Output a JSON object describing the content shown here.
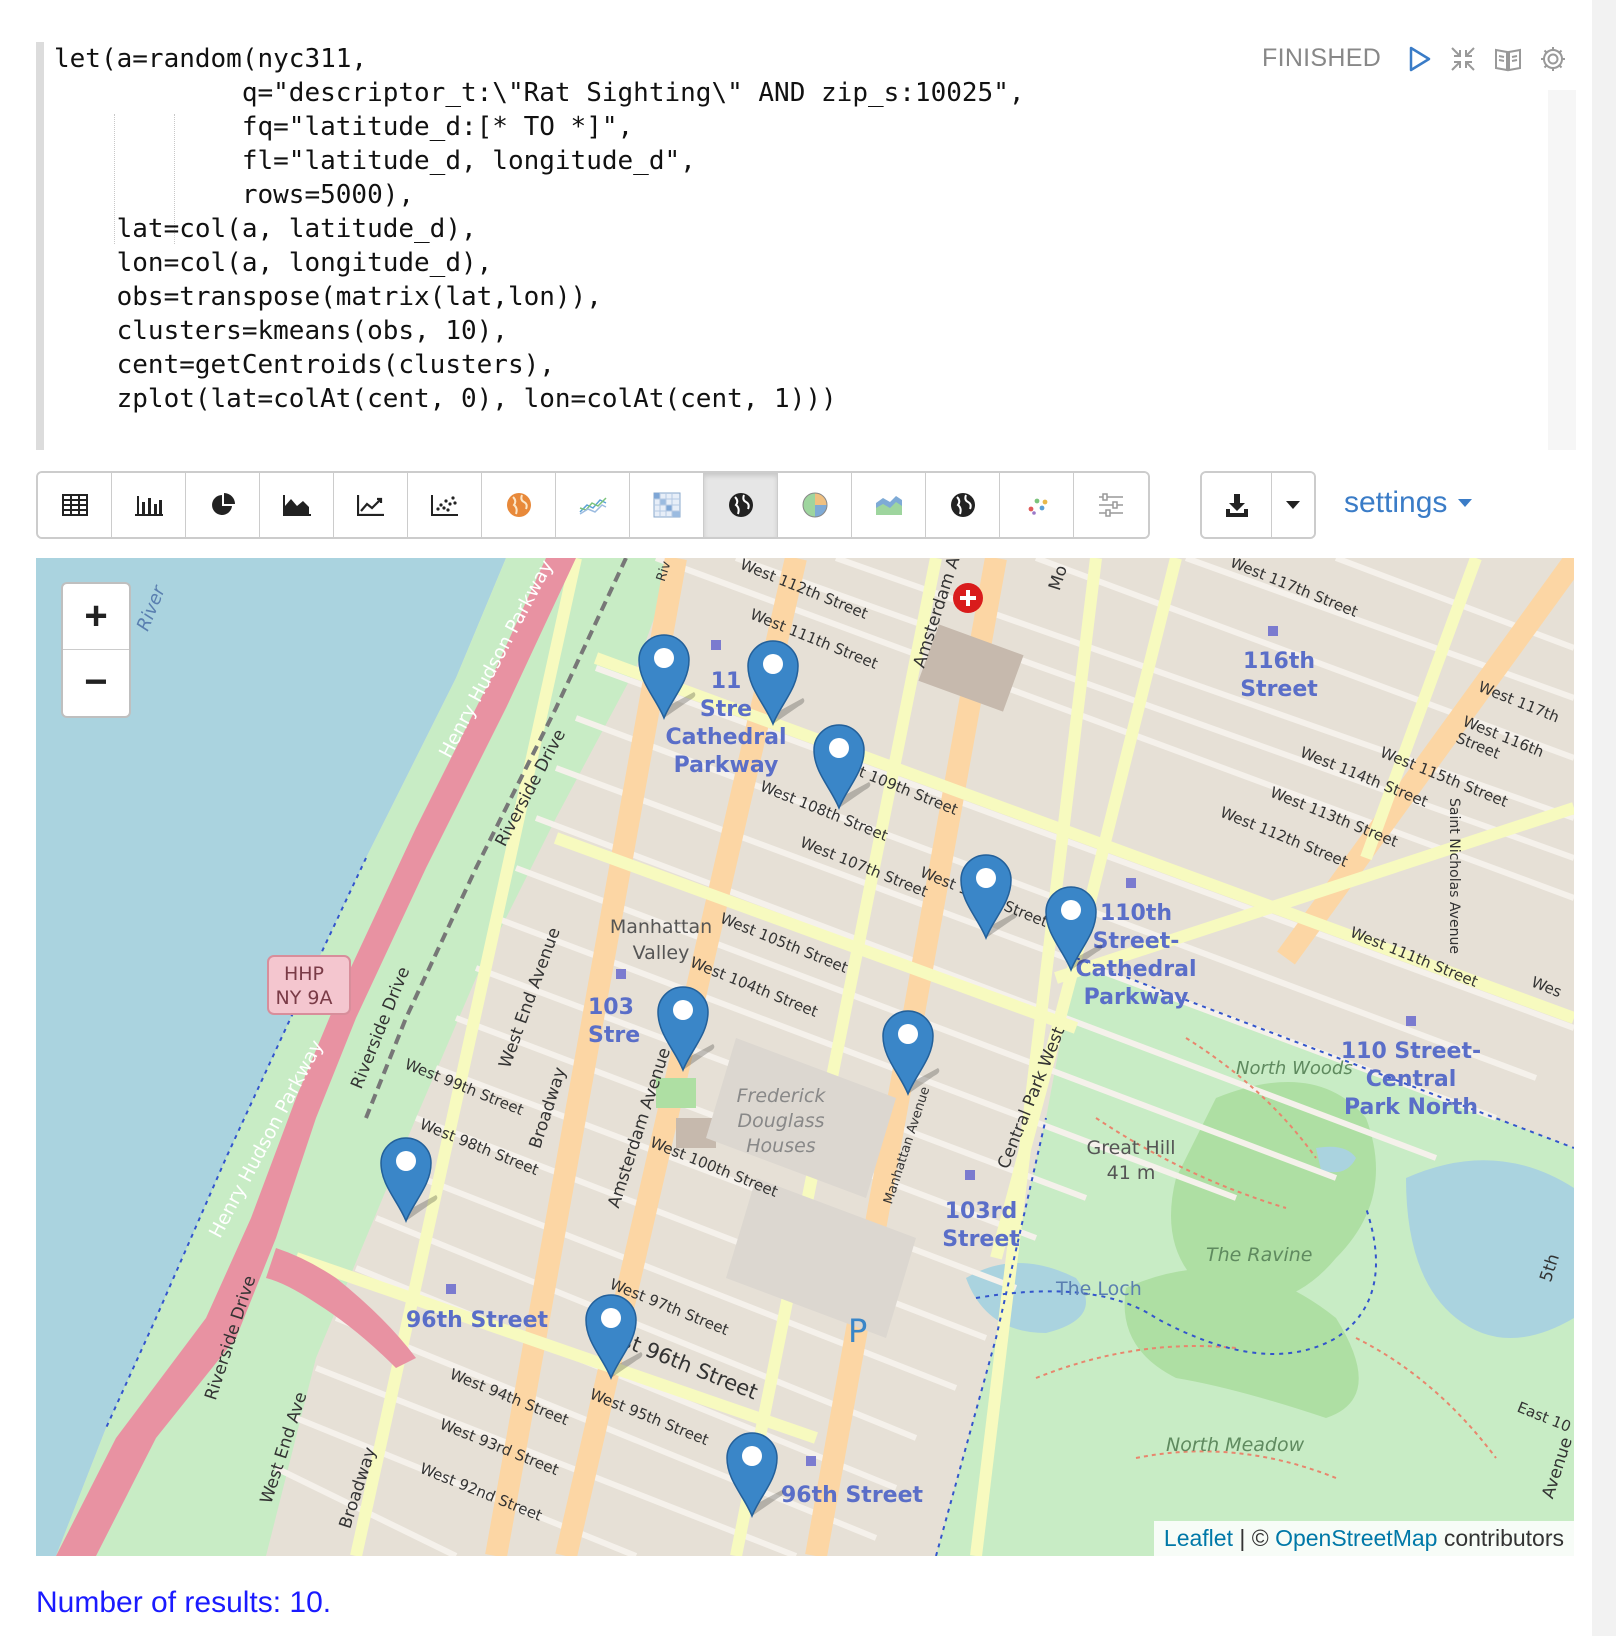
{
  "editor": {
    "code_lines": [
      "let(a=random(nyc311,",
      "            q=\"descriptor_t:\\\"Rat Sighting\\\" AND zip_s:10025\",",
      "            fq=\"latitude_d:[* TO *]\",",
      "            fl=\"latitude_d, longitude_d\",",
      "            rows=5000),",
      "    lat=col(a, latitude_d),",
      "    lon=col(a, longitude_d),",
      "    obs=transpose(matrix(lat,lon)),",
      "    clusters=kmeans(obs, 10),",
      "    cent=getCentroids(clusters),",
      "    zplot(lat=colAt(cent, 0), lon=colAt(cent, 1)))"
    ],
    "status": "FINISHED",
    "icons": [
      "run-icon",
      "collapse-icon",
      "book-icon",
      "gear-icon"
    ]
  },
  "toolbar": {
    "buttons": [
      "table-icon",
      "bar-chart-icon",
      "pie-chart-icon",
      "area-chart-icon",
      "line-chart-icon",
      "scatter-chart-icon",
      "orange-globe-icon",
      "multi-line-icon",
      "heatmap-icon",
      "globe-icon",
      "color-pie-icon",
      "color-area-icon",
      "globe-icon-2",
      "dots-icon",
      "sliders-icon"
    ],
    "active": "globe-icon",
    "download_icon": "download-icon",
    "settings_label": "settings"
  },
  "map": {
    "labels": {
      "street_116": "116th",
      "street_116b": "Street",
      "cathedral_1": "110th",
      "cathedral_2": "Street-",
      "cathedral_3": "Cathedral",
      "cathedral_4": "Parkway",
      "cath_top_1": "11",
      "cath_top_2": "Stre",
      "cath_top_3": "Cathedral",
      "cath_top_4": "Parkway",
      "cpn_1": "110 Street-",
      "cpn_2": "Central",
      "cpn_3": "Park North",
      "manhattan_valley_1": "Manhattan",
      "manhattan_valley_2": "Valley",
      "station_103a": "103",
      "station_103b": "Stre",
      "station_103rd_1": "103rd",
      "station_103rd_2": "Street",
      "station_96_a": "96th Street",
      "station_96_b": "96th Street",
      "hhp_1": "HHP",
      "hhp_2": "NY 9A",
      "frederick_1": "Frederick",
      "frederick_2": "Douglass",
      "frederick_3": "Houses",
      "north_woods": "North Woods",
      "great_hill_1": "Great Hill",
      "great_hill_2": "41 m",
      "the_ravine": "The Ravine",
      "the_loch": "The Loch",
      "north_meadow": "North Meadow",
      "parking": "P",
      "river": "River",
      "henry_hudson_top": "Henry Hudson Parkway",
      "henry_hudson_bottom": "Henry Hudson Parkway",
      "riverside_1": "Riverside Drive",
      "riverside_2": "Riverside Drive",
      "riverside_3": "Riverside Drive",
      "west_end_ave": "West End Avenue",
      "west_end_ave_2": "West End Ave",
      "broadway_1": "Broadway",
      "broadway_2": "Broadway",
      "amsterdam_1": "Amsterdam Avenue",
      "amsterdam_2": "Amsterdam Av",
      "manhattan_ave": "Manhattan Avenue",
      "central_park_west": "Central Park West",
      "saint_nicholas": "Saint Nicholas Avenue",
      "w112": "West 112th Street",
      "w111": "West 111th Street",
      "w109": "West 109th Street",
      "w108": "West 108th Street",
      "w108b": "West 108th Street",
      "w107": "West 107th Street",
      "w105": "West 105th Street",
      "w104": "West 104th Street",
      "w100": "West 100th Street",
      "w99": "West 99th Street",
      "w98": "West 98th Street",
      "w97": "West 97th Street",
      "w96": "West 96th Street",
      "w95": "West 95th Street",
      "w94": "West 94th Street",
      "w93": "West 93rd Street",
      "w92": "West 92nd Street",
      "w117": "West 117th Street",
      "w117b": "West 117th",
      "w116": "West 116th Street",
      "w115": "West 115th Street",
      "w114": "West 114th Street",
      "w113": "West 113th Street",
      "w112b": "West 112th Street",
      "w111b": "West 111th Street",
      "east_10": "East 10",
      "fifth_ave": "5th",
      "avenue_edge": "Avenue",
      "riverside_top": "Riv",
      "mo": "Mo",
      "we": "Wes"
    },
    "zoom_in": "+",
    "zoom_out": "−",
    "attribution": {
      "leaflet": "Leaflet",
      "sep": " | © ",
      "osm": "OpenStreetMap",
      "contrib": " contributors"
    }
  },
  "results_text": "Number of results: 10.",
  "colors": {
    "marker": "#3a86c8",
    "link": "#3a7cc7",
    "results": "#1a1aff",
    "park": "#c8ecc5",
    "water": "#aad3df",
    "highway": "#e892a2",
    "avenue": "#fcd6a4",
    "secondary": "#f7fabf"
  }
}
